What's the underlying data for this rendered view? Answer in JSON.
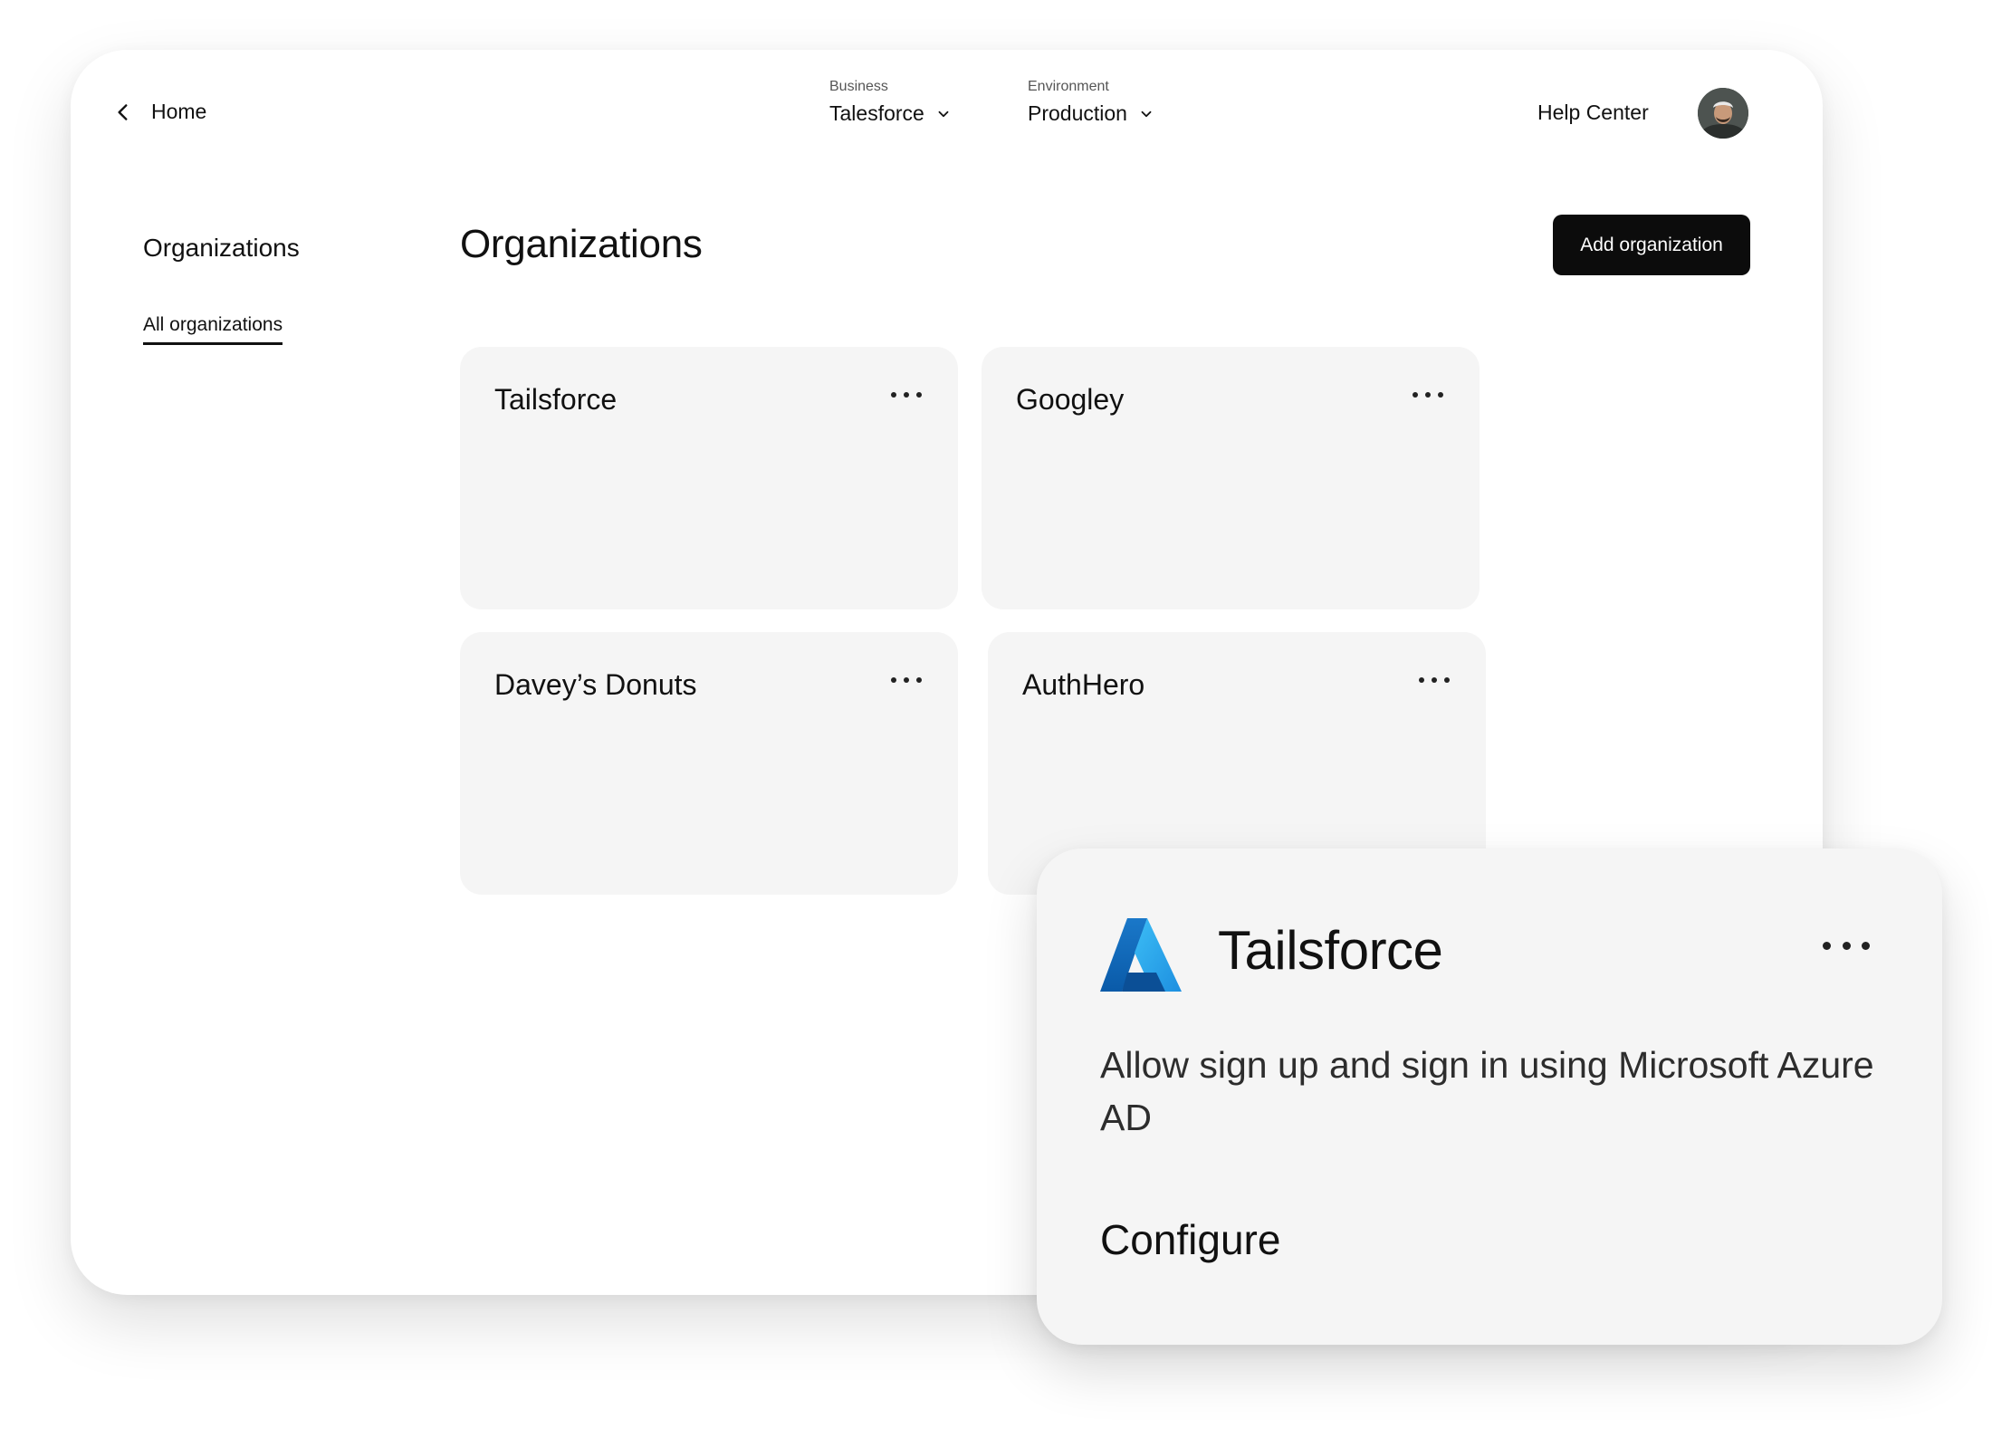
{
  "header": {
    "home_label": "Home",
    "business": {
      "caption": "Business",
      "value": "Talesforce"
    },
    "environment": {
      "caption": "Environment",
      "value": "Production"
    },
    "help_label": "Help Center"
  },
  "sidebar": {
    "title": "Organizations",
    "items": [
      {
        "label": "All organizations",
        "active": true
      }
    ]
  },
  "main": {
    "title": "Organizations",
    "add_button_label": "Add organization",
    "organizations": [
      {
        "name": "Tailsforce"
      },
      {
        "name": "Googley"
      },
      {
        "name": "Davey’s Donuts"
      },
      {
        "name": "AuthHero"
      }
    ]
  },
  "detail_card": {
    "logo_icon": "azure-icon",
    "title": "Tailsforce",
    "description": "Allow sign up and sign in using Microsoft Azure AD",
    "action_label": "Configure"
  },
  "colors": {
    "primary_button": "#0c0c0c",
    "card_background": "#f5f5f5",
    "azure_blue": "#0a6dc2",
    "azure_light": "#38b4f1"
  }
}
